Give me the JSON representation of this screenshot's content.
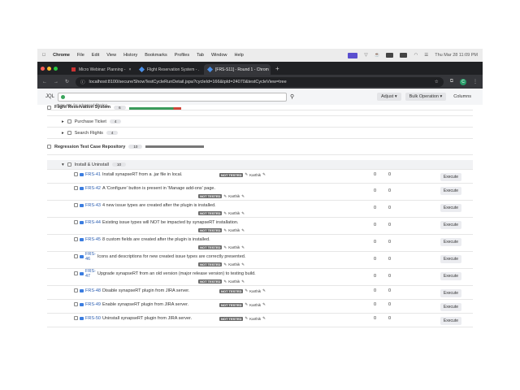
{
  "menubar": {
    "app": "Chrome",
    "items": [
      "File",
      "Edit",
      "View",
      "History",
      "Bookmarks",
      "Profiles",
      "Tab",
      "Window",
      "Help"
    ],
    "clock": "Thu Mar 28  11:09 PM"
  },
  "tabs": [
    {
      "label": "Micro Webinar: Planning -"
    },
    {
      "label": "Flight Reservation System - ."
    },
    {
      "label": "[FRS-S11] - Round 1 - Chrom"
    }
  ],
  "address": {
    "url": "localhost:8100/secure/ShowTestCycleRunDetail.jspa?cycleId=166&tpId=24070&testCycleView=tree",
    "profile": "C"
  },
  "toolbar": {
    "jql_label": "JQL",
    "jql_hint": "Type JQL for advanced filtering.",
    "adjust": "Adjust",
    "bulk": "Bulk Operation",
    "columns": "Columns"
  },
  "tree": {
    "top": {
      "label": "Flight Reservation System",
      "count": "6"
    },
    "purchase": {
      "label": "Purchase Ticket",
      "count": "4"
    },
    "search": {
      "label": "Search Flights",
      "count": "4"
    },
    "regression": {
      "label": "Regression Test Case Repository",
      "count": "10"
    },
    "install": {
      "label": "Install & Uninstall",
      "count": "10"
    }
  },
  "rows": [
    {
      "key": "FRS-41",
      "summary": "Install synapseRT from a .jar file in local.",
      "status": "NOT TESTED",
      "assignee": "Karthik",
      "a": "0",
      "b": "0",
      "action": "Execute"
    },
    {
      "key": "FRS-42",
      "summary": "A 'Configure' button is present in 'Manage add-ons' page.",
      "status": "NOT TESTED",
      "assignee": "Karthik",
      "a": "0",
      "b": "0",
      "action": "Execute"
    },
    {
      "key": "FRS-43",
      "summary": "4 new issue types are created after the plugin is installed.",
      "status": "NOT TESTED",
      "assignee": "Karthik",
      "a": "0",
      "b": "0",
      "action": "Execute"
    },
    {
      "key": "FRS-44",
      "summary": "Existing issue types will NOT be impacted by synapseRT installation.",
      "status": "NOT TESTED",
      "assignee": "Karthik",
      "a": "0",
      "b": "0",
      "action": "Execute"
    },
    {
      "key": "FRS-45",
      "summary": "8 custom fields are created after the plugin is installed.",
      "status": "NOT TESTED",
      "assignee": "Karthik",
      "a": "0",
      "b": "0",
      "action": "Execute"
    },
    {
      "key": "FRS-46",
      "summary": "Icons and descriptions for new created issue types are correctly presented.",
      "status": "NOT TESTED",
      "assignee": "Karthik",
      "a": "0",
      "b": "0",
      "action": "Execute"
    },
    {
      "key": "FRS-47",
      "summary": "Upgrade synapseRT from an old version (major release version) to testing build.",
      "status": "NOT TESTED",
      "assignee": "Karthik",
      "a": "0",
      "b": "0",
      "action": "Execute"
    },
    {
      "key": "FRS-48",
      "summary": "Disable synapseRT plugin from JIRA server.",
      "status": "NOT TESTED",
      "assignee": "Karthik",
      "a": "0",
      "b": "0",
      "action": "Execute"
    },
    {
      "key": "FRS-49",
      "summary": "Enable synapseRT plugin from JIRA server.",
      "status": "NOT TESTED",
      "assignee": "Karthik",
      "a": "0",
      "b": "0",
      "action": "Execute"
    },
    {
      "key": "FRS-50",
      "summary": "Uninstall synapseRT plugin from JIRA server.",
      "status": "NOT TESTED",
      "assignee": "Karthik",
      "a": "0",
      "b": "0",
      "action": "Execute"
    }
  ]
}
